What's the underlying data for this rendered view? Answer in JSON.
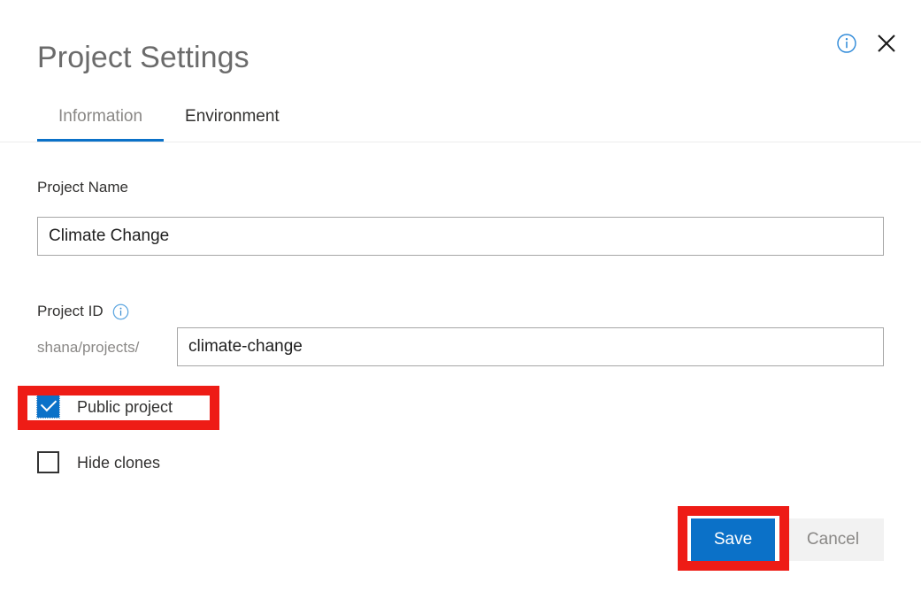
{
  "dialog": {
    "title": "Project Settings",
    "header_icons": {
      "info": "info-circle-icon",
      "close": "close-icon"
    }
  },
  "tabs": [
    {
      "label": "Information",
      "active": true
    },
    {
      "label": "Environment",
      "active": false
    }
  ],
  "form": {
    "project_name": {
      "label": "Project Name",
      "value": "Climate Change",
      "placeholder": "Project Name"
    },
    "project_id": {
      "label": "Project ID",
      "info_icon": "info-circle-icon",
      "prefix": "shana/projects/",
      "value": "climate-change",
      "placeholder": "project-id"
    },
    "checkboxes": [
      {
        "label": "Public project",
        "checked": true
      },
      {
        "label": "Hide clones",
        "checked": false
      }
    ]
  },
  "footer": {
    "save_label": "Save",
    "cancel_label": "Cancel"
  },
  "colors": {
    "accent_blue": "#0b71c8",
    "annotation_red": "#ee1c16",
    "title_gray": "#6b6b6b",
    "muted_gray": "#8a8886",
    "cancel_bg": "#f2f2f2",
    "input_border": "#a6a6a6"
  }
}
